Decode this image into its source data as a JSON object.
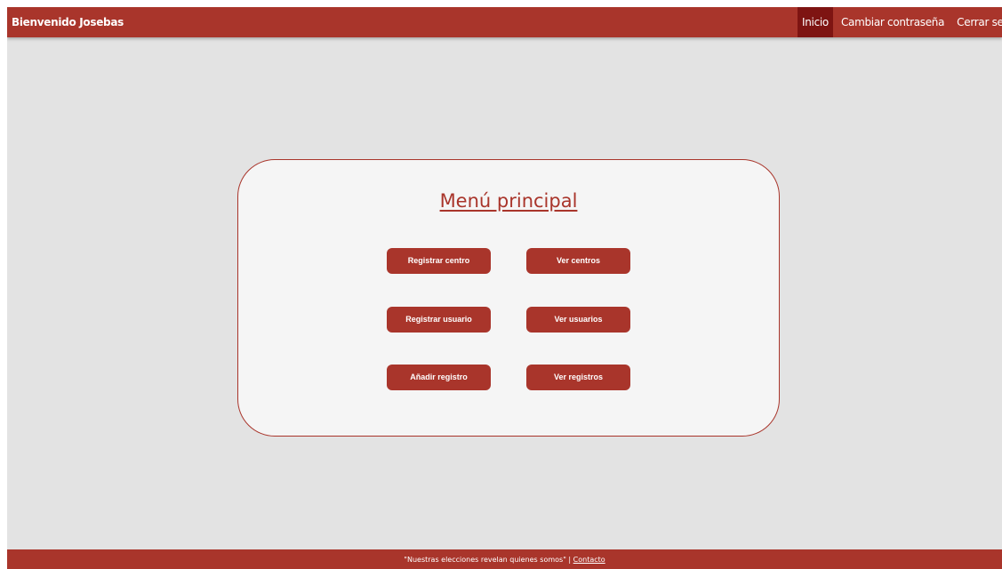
{
  "navbar": {
    "brand": "Bienvenido Josebas",
    "links": [
      {
        "label": "Inicio",
        "active": true
      },
      {
        "label": "Cambiar contraseña",
        "active": false
      },
      {
        "label": "Cerrar sesión",
        "active": false
      }
    ]
  },
  "menu": {
    "title": "Menú principal",
    "buttons": [
      {
        "label": "Registrar centro"
      },
      {
        "label": "Ver centros"
      },
      {
        "label": "Registrar usuario"
      },
      {
        "label": "Ver usuarios"
      },
      {
        "label": "Añadir registro"
      },
      {
        "label": "Ver registros"
      }
    ]
  },
  "footer": {
    "quote": "\"Nuestras elecciones revelan quienes somos\"",
    "separator": " | ",
    "contact_label": "Contacto"
  },
  "colors": {
    "primary": "#a9352b",
    "nav_active": "#7e1412",
    "background": "#e3e3e3",
    "card": "#f5f5f5"
  }
}
